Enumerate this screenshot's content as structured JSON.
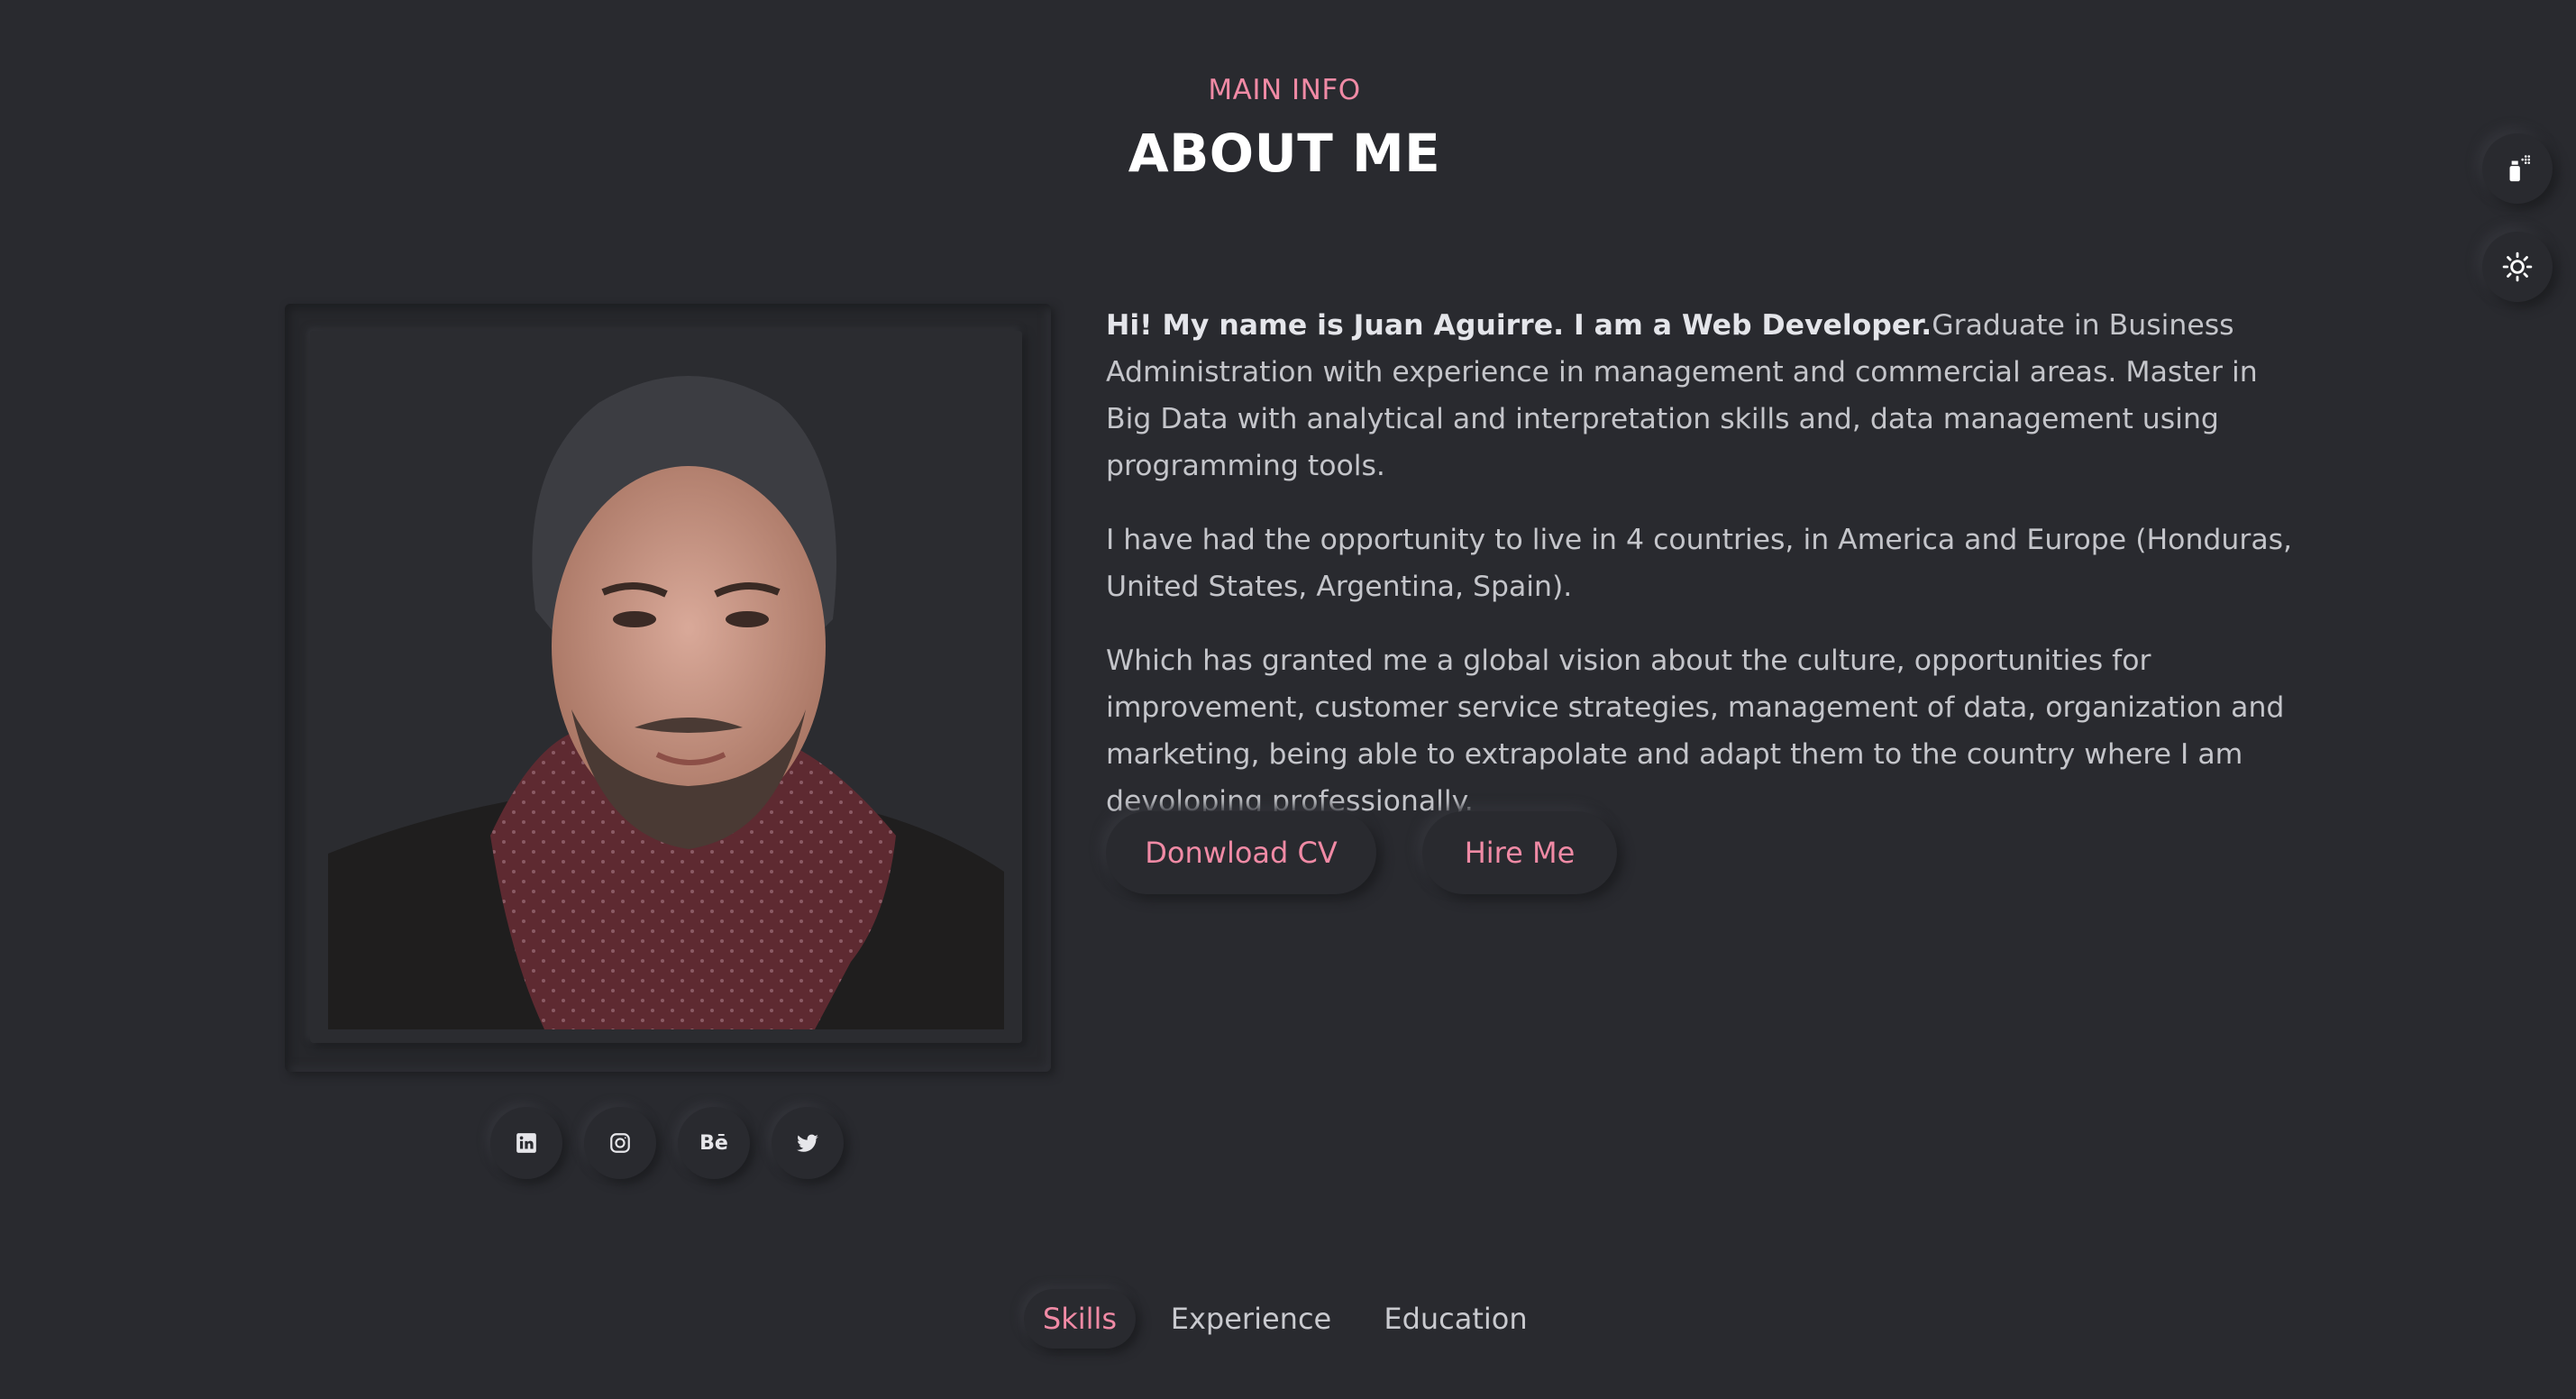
{
  "header": {
    "subtitle": "MAIN INFO",
    "title": "ABOUT ME"
  },
  "side_tools": [
    {
      "icon": "spray-paint-icon"
    },
    {
      "icon": "sun-icon"
    }
  ],
  "profile": {
    "photo_alt": "Portrait photo"
  },
  "social_links": [
    {
      "icon": "linkedin-icon"
    },
    {
      "icon": "instagram-icon"
    },
    {
      "icon": "behance-icon",
      "text": "Bē"
    },
    {
      "icon": "twitter-icon"
    }
  ],
  "bio": {
    "intro_bold": "Hi! My name is Juan Aguirre. I am a Web Developer.",
    "intro_rest": "Graduate in Business Administration with experience in management and commercial areas. Master in Big Data with analytical and interpretation skills and, data management using programming tools.",
    "paragraph2": "I have had the opportunity to live in 4 countries, in America and Europe (Honduras, United States, Argentina, Spain).",
    "paragraph3": "Which has granted me a global vision about the culture, opportunities for improvement, customer service strategies, management of data, organization and marketing, being able to extrapolate and adapt them to the country where I am devoloping professionally."
  },
  "buttons": {
    "download_cv": "Donwload CV",
    "hire_me": "Hire Me"
  },
  "tabs": [
    {
      "label": "Skills",
      "active": true
    },
    {
      "label": "Experience",
      "active": false
    },
    {
      "label": "Education",
      "active": false
    }
  ],
  "colors": {
    "background": "#292a2f",
    "accent": "#f08aa5",
    "title": "#ffffff",
    "text": "#c4c5ca"
  }
}
